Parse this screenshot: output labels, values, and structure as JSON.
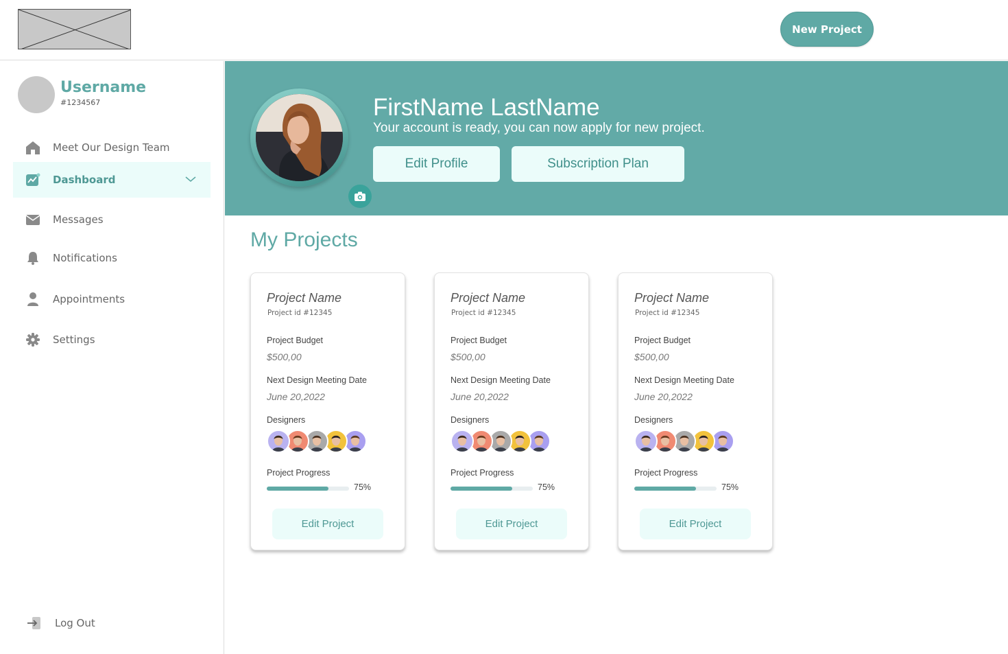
{
  "header": {
    "logo_icon": "image-placeholder-icon",
    "new_project_label": "New Project"
  },
  "user": {
    "username": "Username",
    "user_id": "#1234567"
  },
  "nav": {
    "items": [
      {
        "label": "Meet Our Design Team",
        "icon": "home-icon"
      },
      {
        "label": "Dashboard",
        "icon": "chart-icon",
        "active": true
      },
      {
        "label": "Messages",
        "icon": "envelope-icon"
      },
      {
        "label": "Notifications",
        "icon": "bell-icon"
      },
      {
        "label": "Appointments",
        "icon": "person-icon"
      },
      {
        "label": "Settings",
        "icon": "gear-icon"
      }
    ],
    "logout_label": "Log Out"
  },
  "profile": {
    "full_name": "FirstName LastName",
    "message": "Your account is ready, you can now apply for new project.",
    "edit_profile_label": "Edit Profile",
    "subscription_label": "Subscription Plan"
  },
  "projects": {
    "title": "My Projects",
    "cards": [
      {
        "name": "Project Name",
        "id_text": "Project id #12345",
        "budget_label": "Project Budget",
        "budget_value": "$500,00",
        "meeting_label": "Next Design Meeting Date",
        "meeting_value": "June 20,2022",
        "designers_label": "Designers",
        "progress_label": "Project Progress",
        "progress_percent": 75,
        "progress_text": "75%",
        "edit_label": "Edit Project"
      },
      {
        "name": "Project Name",
        "id_text": "Project id #12345",
        "budget_label": "Project Budget",
        "budget_value": "$500,00",
        "meeting_label": "Next Design Meeting Date",
        "meeting_value": "June 20,2022",
        "designers_label": "Designers",
        "progress_label": "Project Progress",
        "progress_percent": 75,
        "progress_text": "75%",
        "edit_label": "Edit Project"
      },
      {
        "name": "Project Name",
        "id_text": "Project id #12345",
        "budget_label": "Project Budget",
        "budget_value": "$500,00",
        "meeting_label": "Next Design Meeting Date",
        "meeting_value": "June 20,2022",
        "designers_label": "Designers",
        "progress_label": "Project Progress",
        "progress_percent": 75,
        "progress_text": "75%",
        "edit_label": "Edit Project"
      }
    ]
  },
  "colors": {
    "accent": "#5fa9a5",
    "hero_bg": "#62aaa7",
    "light_accent": "#ebfcfa",
    "designer_avatar_bgs": [
      "#b9b2f0",
      "#f08a72",
      "#a9a9a9",
      "#f2c23c",
      "#a99ff0"
    ]
  }
}
